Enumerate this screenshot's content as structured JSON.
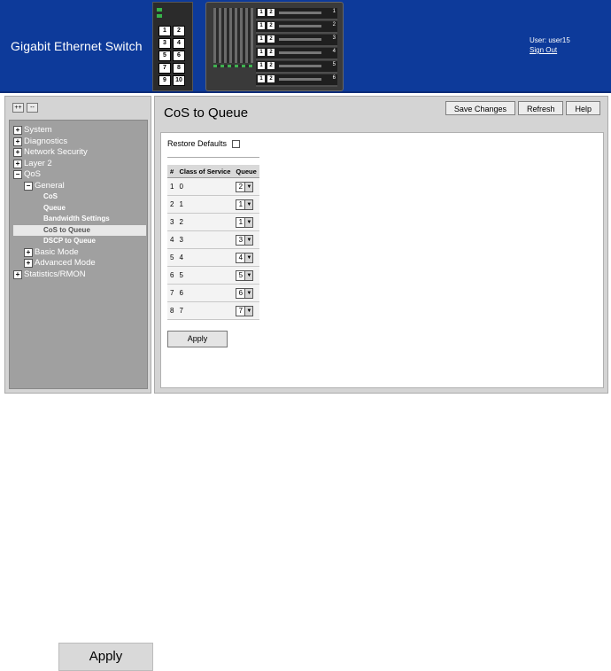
{
  "header": {
    "product_title": "Gigabit Ethernet Switch",
    "user_label": "User: user15",
    "sign_out": "Sign Out"
  },
  "device_small": {
    "ports": [
      "1",
      "2",
      "3",
      "4",
      "5",
      "6",
      "7",
      "8",
      "9",
      "10"
    ]
  },
  "device_chassis": {
    "blades": [
      {
        "p1": "1",
        "p2": "2",
        "num": "1"
      },
      {
        "p1": "1",
        "p2": "2",
        "num": "2"
      },
      {
        "p1": "1",
        "p2": "2",
        "num": "3"
      },
      {
        "p1": "1",
        "p2": "2",
        "num": "4"
      },
      {
        "p1": "1",
        "p2": "2",
        "num": "5"
      },
      {
        "p1": "1",
        "p2": "2",
        "num": "6"
      }
    ]
  },
  "nav": {
    "expand_all": "++",
    "collapse_all": "--",
    "items": [
      {
        "label": "System",
        "icon": "+",
        "level": 0
      },
      {
        "label": "Diagnostics",
        "icon": "+",
        "level": 0
      },
      {
        "label": "Network Security",
        "icon": "+",
        "level": 0
      },
      {
        "label": "Layer 2",
        "icon": "+",
        "level": 0
      },
      {
        "label": "QoS",
        "icon": "−",
        "level": 0
      },
      {
        "label": "General",
        "icon": "−",
        "level": 1
      },
      {
        "label": "CoS",
        "icon": "",
        "level": 2
      },
      {
        "label": "Queue",
        "icon": "",
        "level": 2
      },
      {
        "label": "Bandwidth Settings",
        "icon": "",
        "level": 2
      },
      {
        "label": "CoS to Queue",
        "icon": "",
        "level": 2,
        "selected": true
      },
      {
        "label": "DSCP to Queue",
        "icon": "",
        "level": 2
      },
      {
        "label": "Basic Mode",
        "icon": "+",
        "level": 1
      },
      {
        "label": "Advanced Mode",
        "icon": "+",
        "level": 1
      },
      {
        "label": "Statistics/RMON",
        "icon": "+",
        "level": 0
      }
    ]
  },
  "main": {
    "title": "CoS to Queue",
    "buttons": {
      "save": "Save Changes",
      "refresh": "Refresh",
      "help": "Help"
    },
    "restore_defaults": "Restore Defaults",
    "table": {
      "headers": [
        "#",
        "Class of Service",
        "Queue"
      ],
      "rows": [
        {
          "num": "1",
          "cos": "0",
          "queue": "2"
        },
        {
          "num": "2",
          "cos": "1",
          "queue": "1"
        },
        {
          "num": "3",
          "cos": "2",
          "queue": "1"
        },
        {
          "num": "4",
          "cos": "3",
          "queue": "3"
        },
        {
          "num": "5",
          "cos": "4",
          "queue": "4"
        },
        {
          "num": "6",
          "cos": "5",
          "queue": "5"
        },
        {
          "num": "7",
          "cos": "6",
          "queue": "6"
        },
        {
          "num": "8",
          "cos": "7",
          "queue": "7"
        }
      ]
    },
    "apply": "Apply"
  },
  "apply_large": "Apply",
  "colors": {
    "header_bg": "#0d3a9a",
    "nav_bg": "#a0a0a0",
    "frame_bg": "#d4d4d4"
  }
}
